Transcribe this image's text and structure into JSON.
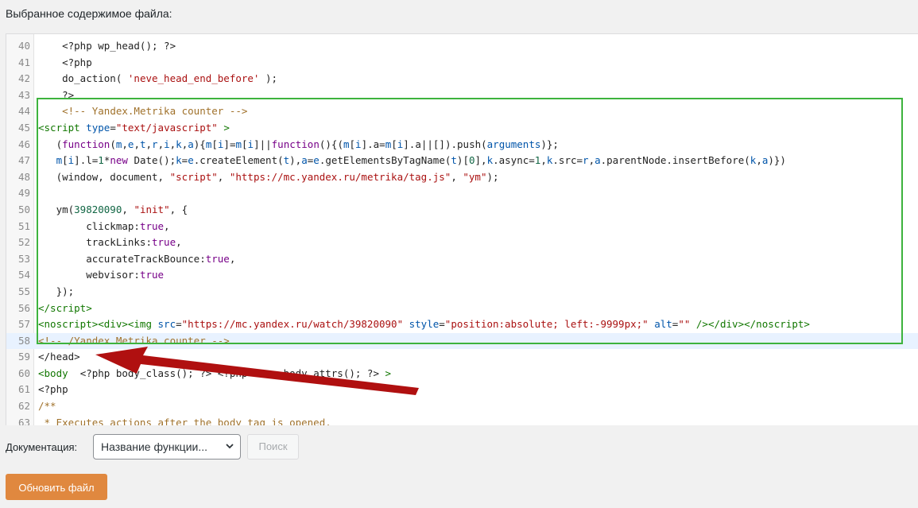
{
  "section_title": "Выбранное содержимое файла:",
  "editor": {
    "lines": [
      {
        "num": "40",
        "html": "    &lt;?php wp_head(); ?&gt;"
      },
      {
        "num": "41",
        "html": "    &lt;?php"
      },
      {
        "num": "42",
        "html": "    do_action( <span class=\"c-str\">'neve_head_end_before'</span> );"
      },
      {
        "num": "43",
        "html": "    ?&gt;"
      },
      {
        "num": "44",
        "html": "    <span class=\"c-com\">&lt;!-- Yandex.Metrika counter --&gt;</span>"
      },
      {
        "num": "45",
        "html": "<span class=\"c-tag\">&lt;script</span> <span class=\"c-var\">type</span>=<span class=\"c-str\">\"text/javascript\"</span> <span class=\"c-tag\">&gt;</span>"
      },
      {
        "num": "46",
        "html": "   (<span class=\"c-kw\">function</span>(<span class=\"c-var\">m</span>,<span class=\"c-var\">e</span>,<span class=\"c-var\">t</span>,<span class=\"c-var\">r</span>,<span class=\"c-var\">i</span>,<span class=\"c-var\">k</span>,<span class=\"c-var\">a</span>){<span class=\"c-var\">m</span>[<span class=\"c-var\">i</span>]=<span class=\"c-var\">m</span>[<span class=\"c-var\">i</span>]||<span class=\"c-kw\">function</span>(){(<span class=\"c-var\">m</span>[<span class=\"c-var\">i</span>].a=<span class=\"c-var\">m</span>[<span class=\"c-var\">i</span>].a||[]).push(<span class=\"c-var\">arguments</span>)};"
      },
      {
        "num": "47",
        "html": "   <span class=\"c-var\">m</span>[<span class=\"c-var\">i</span>].l=<span class=\"c-num\">1</span>*<span class=\"c-kw\">new</span> Date();<span class=\"c-var\">k</span>=<span class=\"c-var\">e</span>.createElement(<span class=\"c-var\">t</span>),<span class=\"c-var\">a</span>=<span class=\"c-var\">e</span>.getElementsByTagName(<span class=\"c-var\">t</span>)[<span class=\"c-num\">0</span>],<span class=\"c-var\">k</span>.async=<span class=\"c-num\">1</span>,<span class=\"c-var\">k</span>.src=<span class=\"c-var\">r</span>,<span class=\"c-var\">a</span>.parentNode.insertBefore(<span class=\"c-var\">k</span>,<span class=\"c-var\">a</span>)})"
      },
      {
        "num": "48",
        "html": "   (window, document, <span class=\"c-str\">\"script\"</span>, <span class=\"c-str\">\"https://mc.yandex.ru/metrika/tag.js\"</span>, <span class=\"c-str\">\"ym\"</span>);"
      },
      {
        "num": "49",
        "html": ""
      },
      {
        "num": "50",
        "html": "   ym(<span class=\"c-num\">39820090</span>, <span class=\"c-str\">\"init\"</span>, {"
      },
      {
        "num": "51",
        "html": "        clickmap:<span class=\"c-kw\">true</span>,"
      },
      {
        "num": "52",
        "html": "        trackLinks:<span class=\"c-kw\">true</span>,"
      },
      {
        "num": "53",
        "html": "        accurateTrackBounce:<span class=\"c-kw\">true</span>,"
      },
      {
        "num": "54",
        "html": "        webvisor:<span class=\"c-kw\">true</span>"
      },
      {
        "num": "55",
        "html": "   });"
      },
      {
        "num": "56",
        "html": "<span class=\"c-tag\">&lt;/script&gt;</span>"
      },
      {
        "num": "57",
        "html": "<span class=\"c-tag\">&lt;noscript&gt;&lt;div&gt;&lt;img</span> <span class=\"c-var\">src</span>=<span class=\"c-str\">\"https://mc.yandex.ru/watch/39820090\"</span> <span class=\"c-var\">style</span>=<span class=\"c-str\">\"position:absolute; left:-9999px;\"</span> <span class=\"c-var\">alt</span>=<span class=\"c-str\">\"\"</span> <span class=\"c-tag\">/&gt;&lt;/div&gt;&lt;/noscript&gt;</span>"
      },
      {
        "num": "58",
        "html": "<span class=\"c-com\">&lt;!-- /Yandex.Metrika counter --&gt;</span>",
        "active": true
      },
      {
        "num": "59",
        "html": "&lt;/head&gt;"
      },
      {
        "num": "60",
        "html": "<span class=\"c-tag\">&lt;body</span>  &lt;?php body_class(); ?&gt; &lt;?php neve_body_attrs(); ?&gt; <span class=\"c-tag\">&gt;</span>"
      },
      {
        "num": "61",
        "html": "&lt;?php"
      },
      {
        "num": "62",
        "html": "<span class=\"c-com\">/**</span>"
      },
      {
        "num": "63",
        "html": "<span class=\"c-com\"> * Executes actions after the body tag is opened.</span>"
      }
    ]
  },
  "documentation": {
    "label": "Документация:",
    "select_value": "Название функции...",
    "search_label": "Поиск"
  },
  "update_button": "Обновить файл",
  "colors": {
    "highlight_border": "#3db33d",
    "arrow": "#b01010",
    "update_button_bg": "#e0883f"
  }
}
